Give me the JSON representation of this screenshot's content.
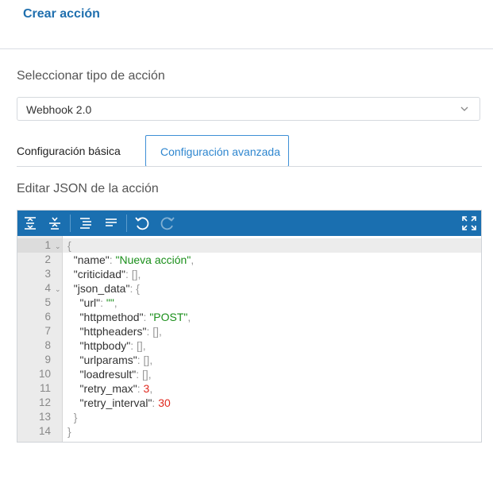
{
  "header": {
    "title": "Crear acción"
  },
  "action_type": {
    "label": "Seleccionar tipo de acción",
    "selected": "Webhook 2.0"
  },
  "tabs": [
    {
      "label": "Configuración básica",
      "active": false
    },
    {
      "label": "Configuración avanzada",
      "active": true
    }
  ],
  "editor": {
    "label": "Editar JSON de la acción",
    "toolbar": [
      "expand-all-icon",
      "collapse-all-icon",
      "format-icon",
      "compact-icon",
      "undo-icon",
      "redo-icon",
      "fullscreen-icon"
    ],
    "lines": [
      {
        "n": "1",
        "fold": true,
        "tokens": [
          [
            "p",
            "{"
          ]
        ]
      },
      {
        "n": "2",
        "fold": false,
        "tokens": [
          [
            "k",
            "  \"name\""
          ],
          [
            "p",
            ": "
          ],
          [
            "s",
            "\"Nueva acción\""
          ],
          [
            "p",
            ","
          ]
        ]
      },
      {
        "n": "3",
        "fold": false,
        "tokens": [
          [
            "k",
            "  \"criticidad\""
          ],
          [
            "p",
            ": "
          ],
          [
            "p",
            "[]"
          ],
          [
            "p",
            ","
          ]
        ]
      },
      {
        "n": "4",
        "fold": true,
        "tokens": [
          [
            "k",
            "  \"json_data\""
          ],
          [
            "p",
            ": {"
          ]
        ]
      },
      {
        "n": "5",
        "fold": false,
        "tokens": [
          [
            "k",
            "    \"url\""
          ],
          [
            "p",
            ": "
          ],
          [
            "s",
            "\"\""
          ],
          [
            "p",
            ","
          ]
        ]
      },
      {
        "n": "6",
        "fold": false,
        "tokens": [
          [
            "k",
            "    \"httpmethod\""
          ],
          [
            "p",
            ": "
          ],
          [
            "s",
            "\"POST\""
          ],
          [
            "p",
            ","
          ]
        ]
      },
      {
        "n": "7",
        "fold": false,
        "tokens": [
          [
            "k",
            "    \"httpheaders\""
          ],
          [
            "p",
            ": "
          ],
          [
            "p",
            "[]"
          ],
          [
            "p",
            ","
          ]
        ]
      },
      {
        "n": "8",
        "fold": false,
        "tokens": [
          [
            "k",
            "    \"httpbody\""
          ],
          [
            "p",
            ": "
          ],
          [
            "p",
            "[]"
          ],
          [
            "p",
            ","
          ]
        ]
      },
      {
        "n": "9",
        "fold": false,
        "tokens": [
          [
            "k",
            "    \"urlparams\""
          ],
          [
            "p",
            ": "
          ],
          [
            "p",
            "[]"
          ],
          [
            "p",
            ","
          ]
        ]
      },
      {
        "n": "10",
        "fold": false,
        "tokens": [
          [
            "k",
            "    \"loadresult\""
          ],
          [
            "p",
            ": "
          ],
          [
            "p",
            "[]"
          ],
          [
            "p",
            ","
          ]
        ]
      },
      {
        "n": "11",
        "fold": false,
        "tokens": [
          [
            "k",
            "    \"retry_max\""
          ],
          [
            "p",
            ": "
          ],
          [
            "n",
            "3"
          ],
          [
            "p",
            ","
          ]
        ]
      },
      {
        "n": "12",
        "fold": false,
        "tokens": [
          [
            "k",
            "    \"retry_interval\""
          ],
          [
            "p",
            ": "
          ],
          [
            "n",
            "30"
          ]
        ]
      },
      {
        "n": "13",
        "fold": false,
        "tokens": [
          [
            "p",
            "  }"
          ]
        ]
      },
      {
        "n": "14",
        "fold": false,
        "tokens": [
          [
            "p",
            "}"
          ]
        ]
      }
    ]
  },
  "colors": {
    "accent": "#1f6fae",
    "toolbar": "#1a6fb0",
    "string": "#1a8f1a",
    "number": "#e0291f"
  }
}
